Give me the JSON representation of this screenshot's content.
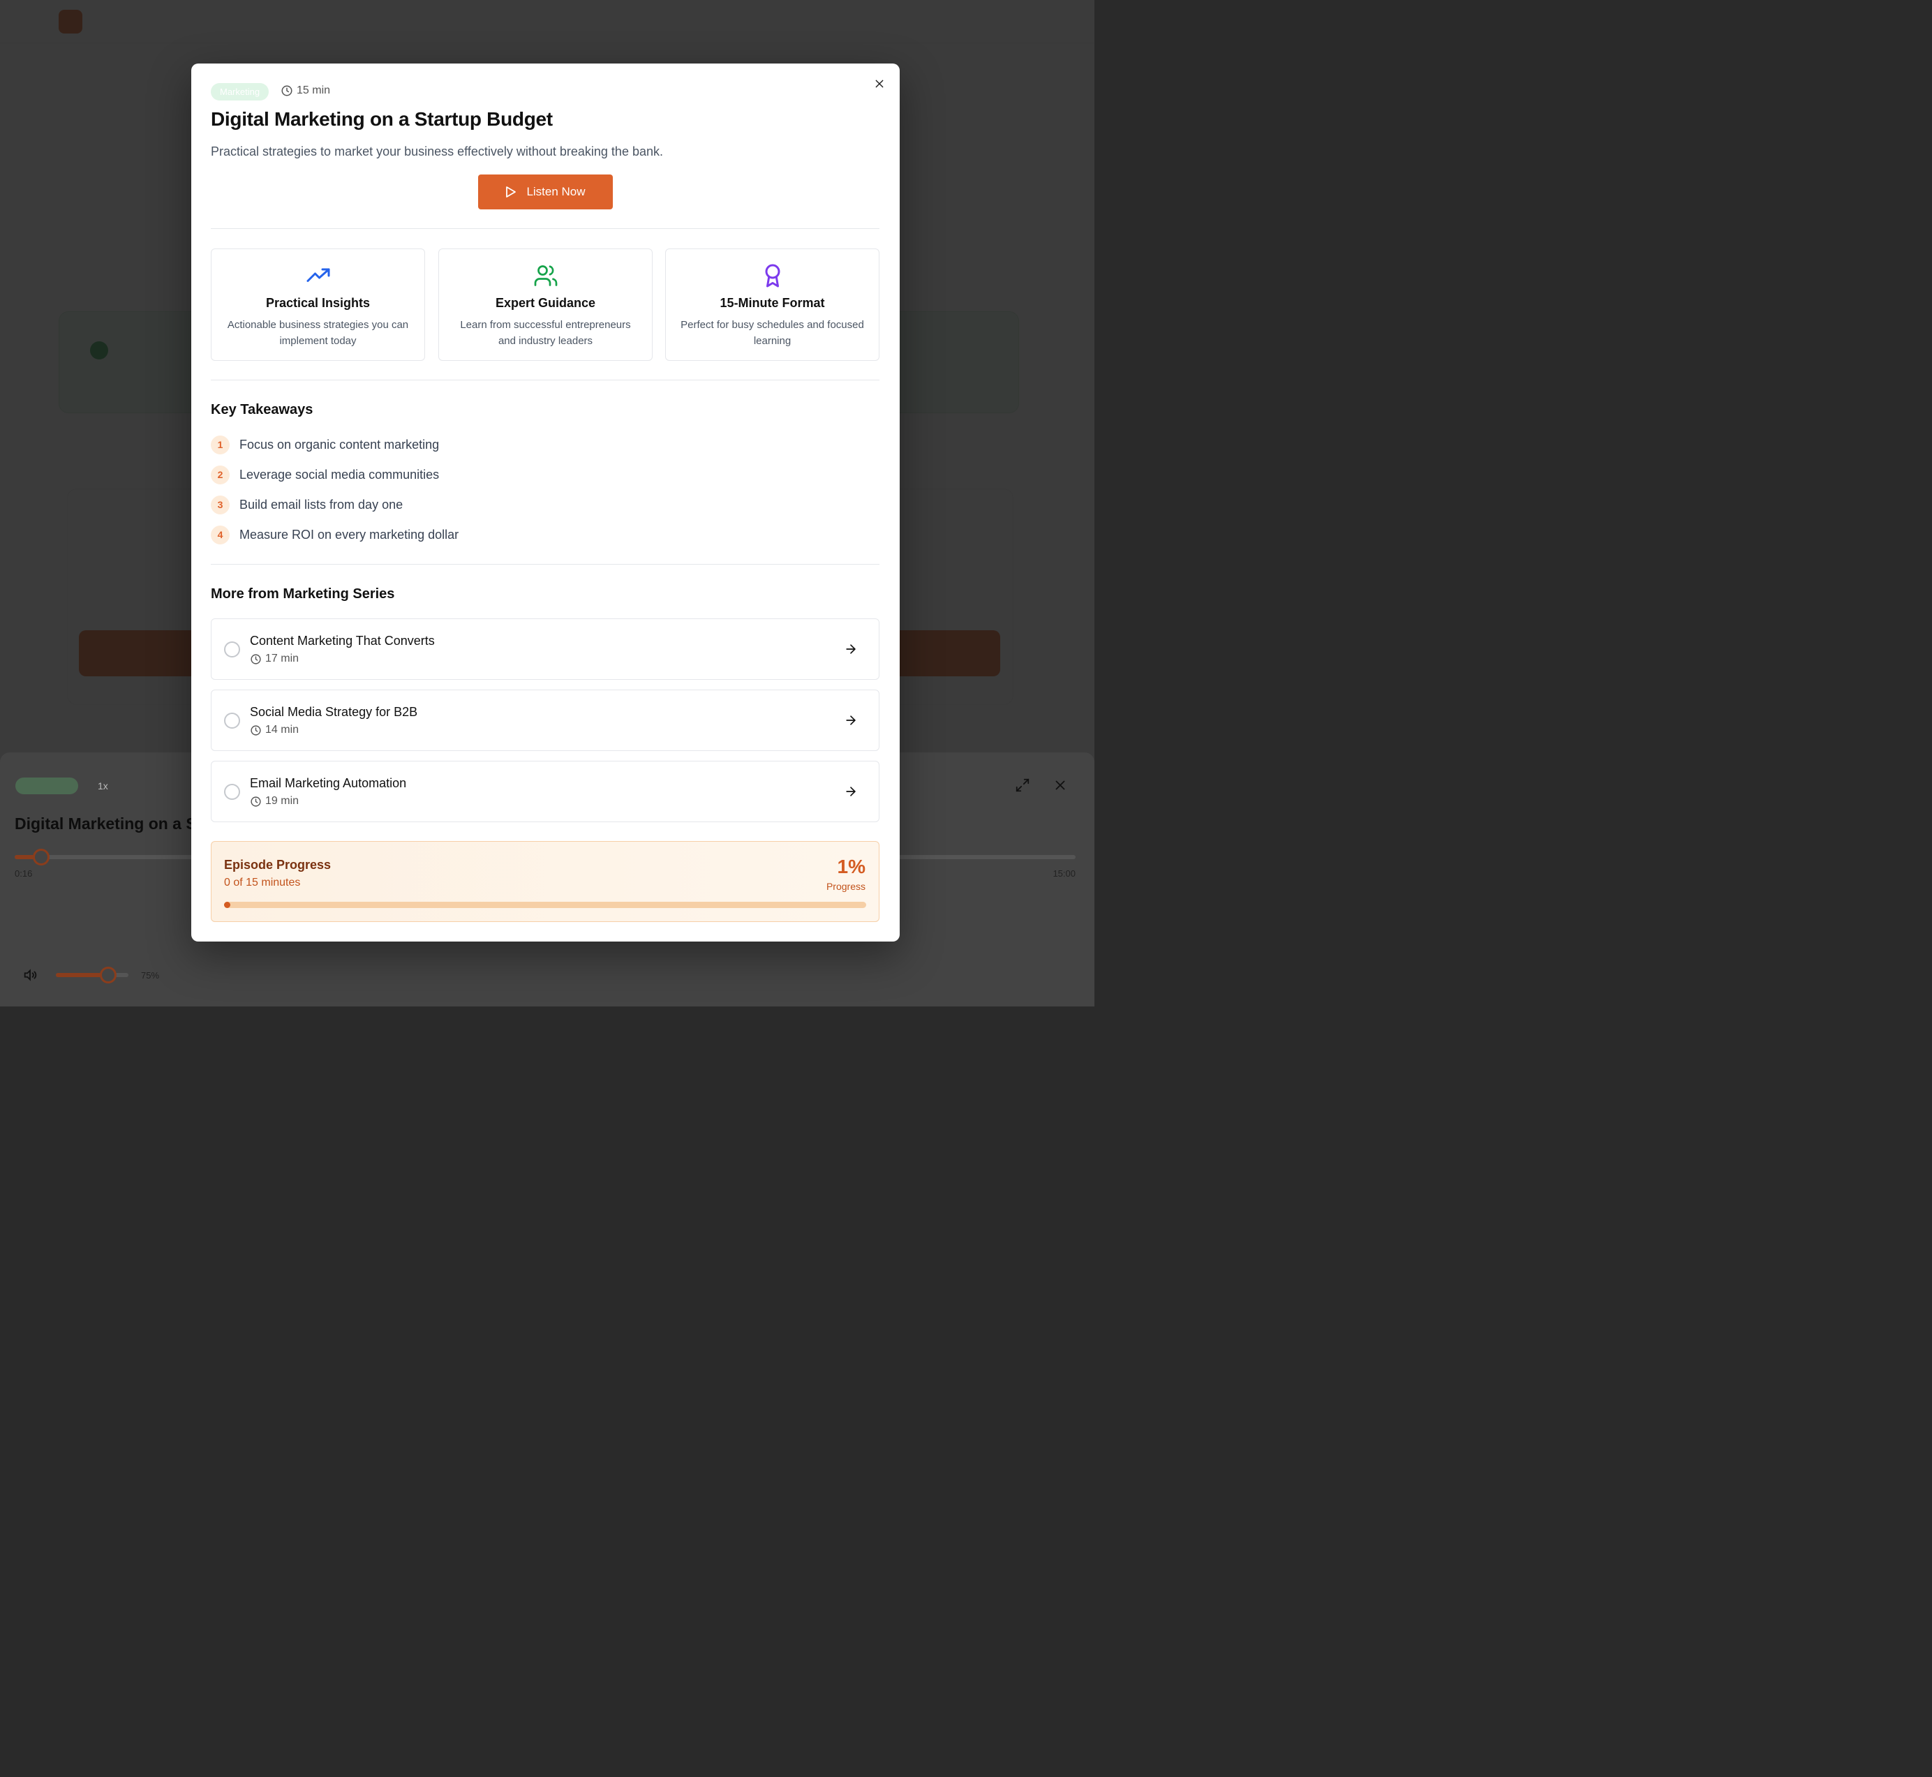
{
  "colors": {
    "accent": "#dd622b",
    "tag_bg": "#dff5e6",
    "insights_icon": "#2563eb",
    "guidance_icon": "#16a34a",
    "format_icon": "#7c3aed"
  },
  "background": {
    "player": {
      "speed": "1x",
      "current_time": "0:16",
      "duration": "15:00",
      "volume": "75%",
      "progress_fraction": 0.018,
      "volume_fraction": 0.75
    }
  },
  "modal": {
    "tag": "Marketing",
    "duration": "15 min",
    "title": "Digital Marketing on a Startup Budget",
    "description": "Practical strategies to market your business effectively without breaking the bank.",
    "listen_label": "Listen Now",
    "features": [
      {
        "icon": "trending-up-icon",
        "title": "Practical Insights",
        "description": "Actionable business strategies you can implement today"
      },
      {
        "icon": "users-icon",
        "title": "Expert Guidance",
        "description": "Learn from successful entrepreneurs and industry leaders"
      },
      {
        "icon": "award-icon",
        "title": "15-Minute Format",
        "description": "Perfect for busy schedules and focused learning"
      }
    ],
    "takeaways_heading": "Key Takeaways",
    "takeaways": [
      {
        "num": "1",
        "text": "Focus on organic content marketing"
      },
      {
        "num": "2",
        "text": "Leverage social media communities"
      },
      {
        "num": "3",
        "text": "Build email lists from day one"
      },
      {
        "num": "4",
        "text": "Measure ROI on every marketing dollar"
      }
    ],
    "more_heading": "More from Marketing Series",
    "more_episodes": [
      {
        "title": "Content Marketing That Converts",
        "duration": "17 min"
      },
      {
        "title": "Social Media Strategy for B2B",
        "duration": "14 min"
      },
      {
        "title": "Email Marketing Automation",
        "duration": "19 min"
      }
    ],
    "progress": {
      "title": "Episode Progress",
      "subtitle": "0 of 15 minutes",
      "percent_label": "1%",
      "caption": "Progress",
      "fraction": 0.01
    }
  }
}
